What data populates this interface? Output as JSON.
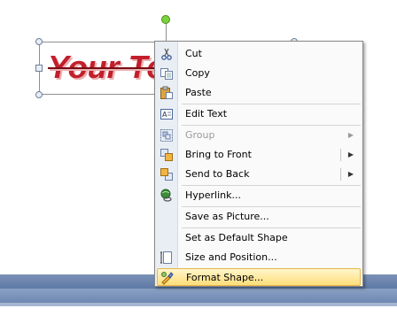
{
  "canvas": {
    "word_art_text": "Your Te"
  },
  "context_menu": {
    "items": [
      {
        "label": "Cut",
        "icon": "scissors-icon",
        "enabled": true,
        "submenu": false
      },
      {
        "label": "Copy",
        "icon": "copy-icon",
        "enabled": true,
        "submenu": false
      },
      {
        "label": "Paste",
        "icon": "paste-icon",
        "enabled": true,
        "submenu": false
      },
      {
        "label": "Edit Text",
        "icon": "edit-text-icon",
        "enabled": true,
        "submenu": false
      },
      {
        "label": "Group",
        "icon": "group-icon",
        "enabled": false,
        "submenu": true
      },
      {
        "label": "Bring to Front",
        "icon": "bring-to-front-icon",
        "enabled": true,
        "submenu": true
      },
      {
        "label": "Send to Back",
        "icon": "send-to-back-icon",
        "enabled": true,
        "submenu": true
      },
      {
        "label": "Hyperlink...",
        "icon": "hyperlink-icon",
        "enabled": true,
        "submenu": false
      },
      {
        "label": "Save as Picture...",
        "icon": "",
        "enabled": true,
        "submenu": false
      },
      {
        "label": "Set as Default Shape",
        "icon": "",
        "enabled": true,
        "submenu": false
      },
      {
        "label": "Size and Position...",
        "icon": "size-position-icon",
        "enabled": true,
        "submenu": false
      },
      {
        "label": "Format Shape...",
        "icon": "format-shape-icon",
        "enabled": true,
        "submenu": false,
        "highlighted": true
      }
    ],
    "highlight_colors": {
      "top": "#fff6cc",
      "bottom": "#ffde7a",
      "border": "#e7b64a"
    }
  },
  "colors": {
    "word_art": "#c21f2b",
    "rotation_handle": "#7ad23c",
    "taskbar": "#5d79a6"
  }
}
